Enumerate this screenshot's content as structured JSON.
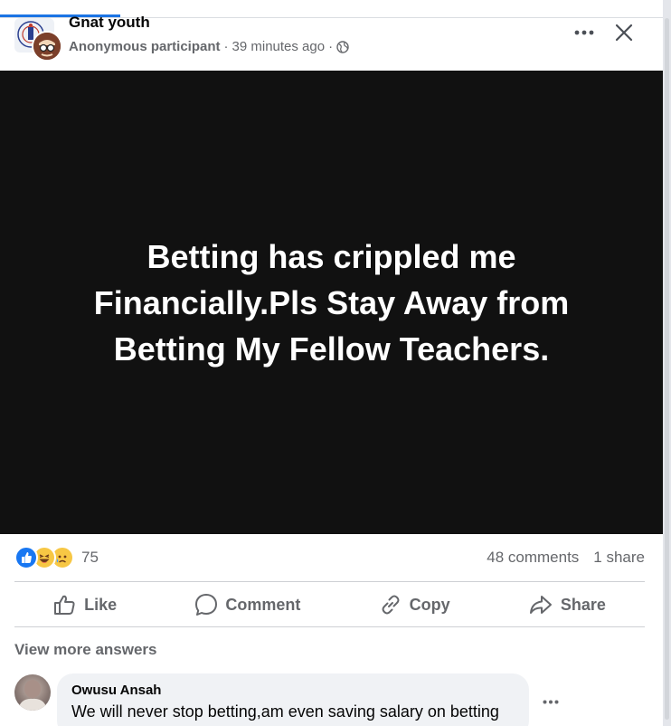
{
  "post": {
    "group_name": "Gnat youth",
    "author": "Anonymous participant",
    "separator": "·",
    "time": "39 minutes ago",
    "privacy_icon": "globe-icon",
    "body_text": "Betting has crippled me Financially.Pls Stay Away from Betting My Fellow Teachers."
  },
  "engagement": {
    "reaction_icons": [
      "like-icon",
      "haha-icon",
      "sad-icon"
    ],
    "reaction_count": "75",
    "comments": "48 comments",
    "shares": "1 share"
  },
  "actions": {
    "like": "Like",
    "comment": "Comment",
    "copy": "Copy",
    "share": "Share"
  },
  "comments_section": {
    "view_more": "View more answers",
    "items": [
      {
        "name": "Owusu Ansah",
        "text": "We will never stop betting,am even saving salary on betting"
      }
    ]
  },
  "colors": {
    "accent": "#1b74e4",
    "post_background": "#111111",
    "secondary_text": "#65676b",
    "bubble": "#f0f2f5"
  }
}
